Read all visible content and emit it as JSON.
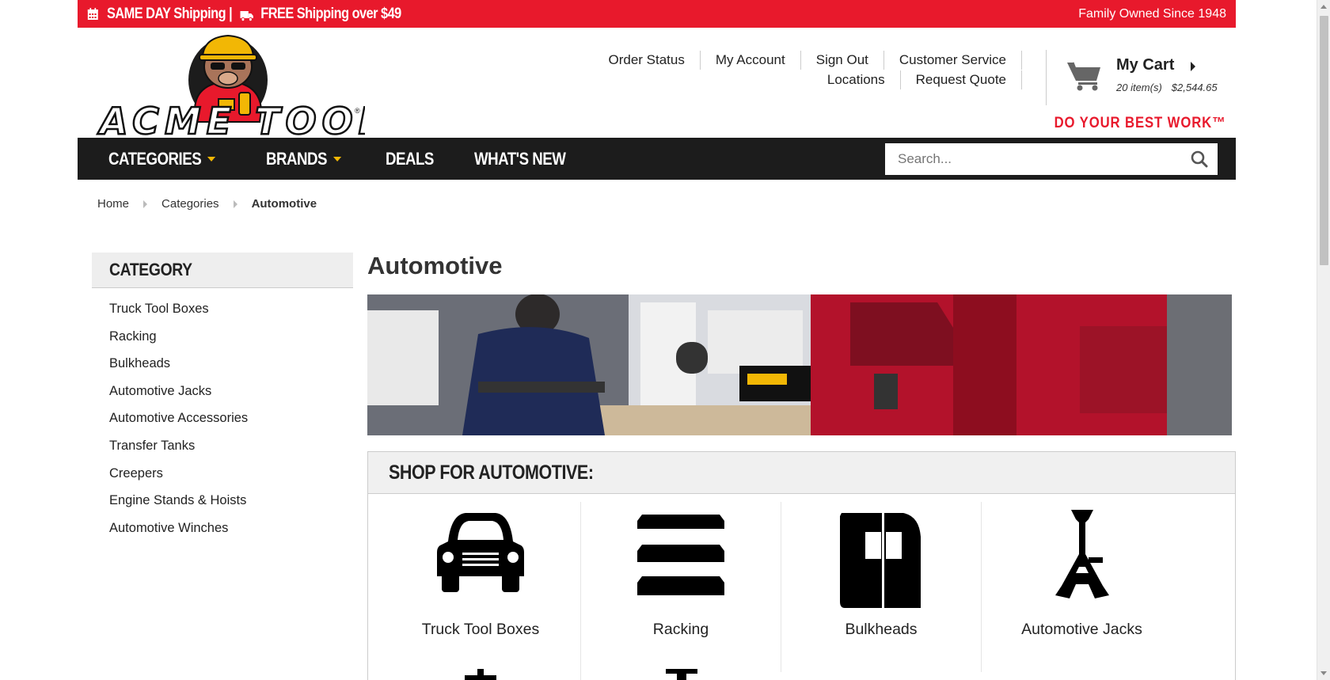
{
  "topbar": {
    "shipping_text": "SAME DAY Shipping | ",
    "free_shipping_text": "FREE Shipping over $49",
    "family_text": "Family Owned Since 1948"
  },
  "header": {
    "logo_text": "ACME TOOLS",
    "links_row1": [
      "Order Status",
      "My Account",
      "Sign Out",
      "Customer Service"
    ],
    "links_row2": [
      "Locations",
      "Request Quote"
    ],
    "cart": {
      "title": "My Cart",
      "items": "20 item(s)",
      "total": "$2,544.65"
    },
    "tagline": "DO YOUR BEST WORK™"
  },
  "nav": {
    "items": [
      "CATEGORIES",
      "BRANDS",
      "DEALS",
      "WHAT'S NEW"
    ],
    "search_placeholder": "Search..."
  },
  "breadcrumb": [
    "Home",
    "Categories",
    "Automotive"
  ],
  "sidebar": {
    "heading": "CATEGORY",
    "items": [
      "Truck Tool Boxes",
      "Racking",
      "Bulkheads",
      "Automotive Jacks",
      "Automotive Accessories",
      "Transfer Tanks",
      "Creepers",
      "Engine Stands & Hoists",
      "Automotive Winches"
    ]
  },
  "main": {
    "title": "Automotive",
    "shop_heading": "SHOP FOR AUTOMOTIVE:",
    "tiles": [
      "Truck Tool Boxes",
      "Racking",
      "Bulkheads",
      "Automotive Jacks"
    ]
  },
  "colors": {
    "brand_red": "#e8192c",
    "nav_bg": "#1c1c1c",
    "accent_yellow": "#f2b705"
  }
}
